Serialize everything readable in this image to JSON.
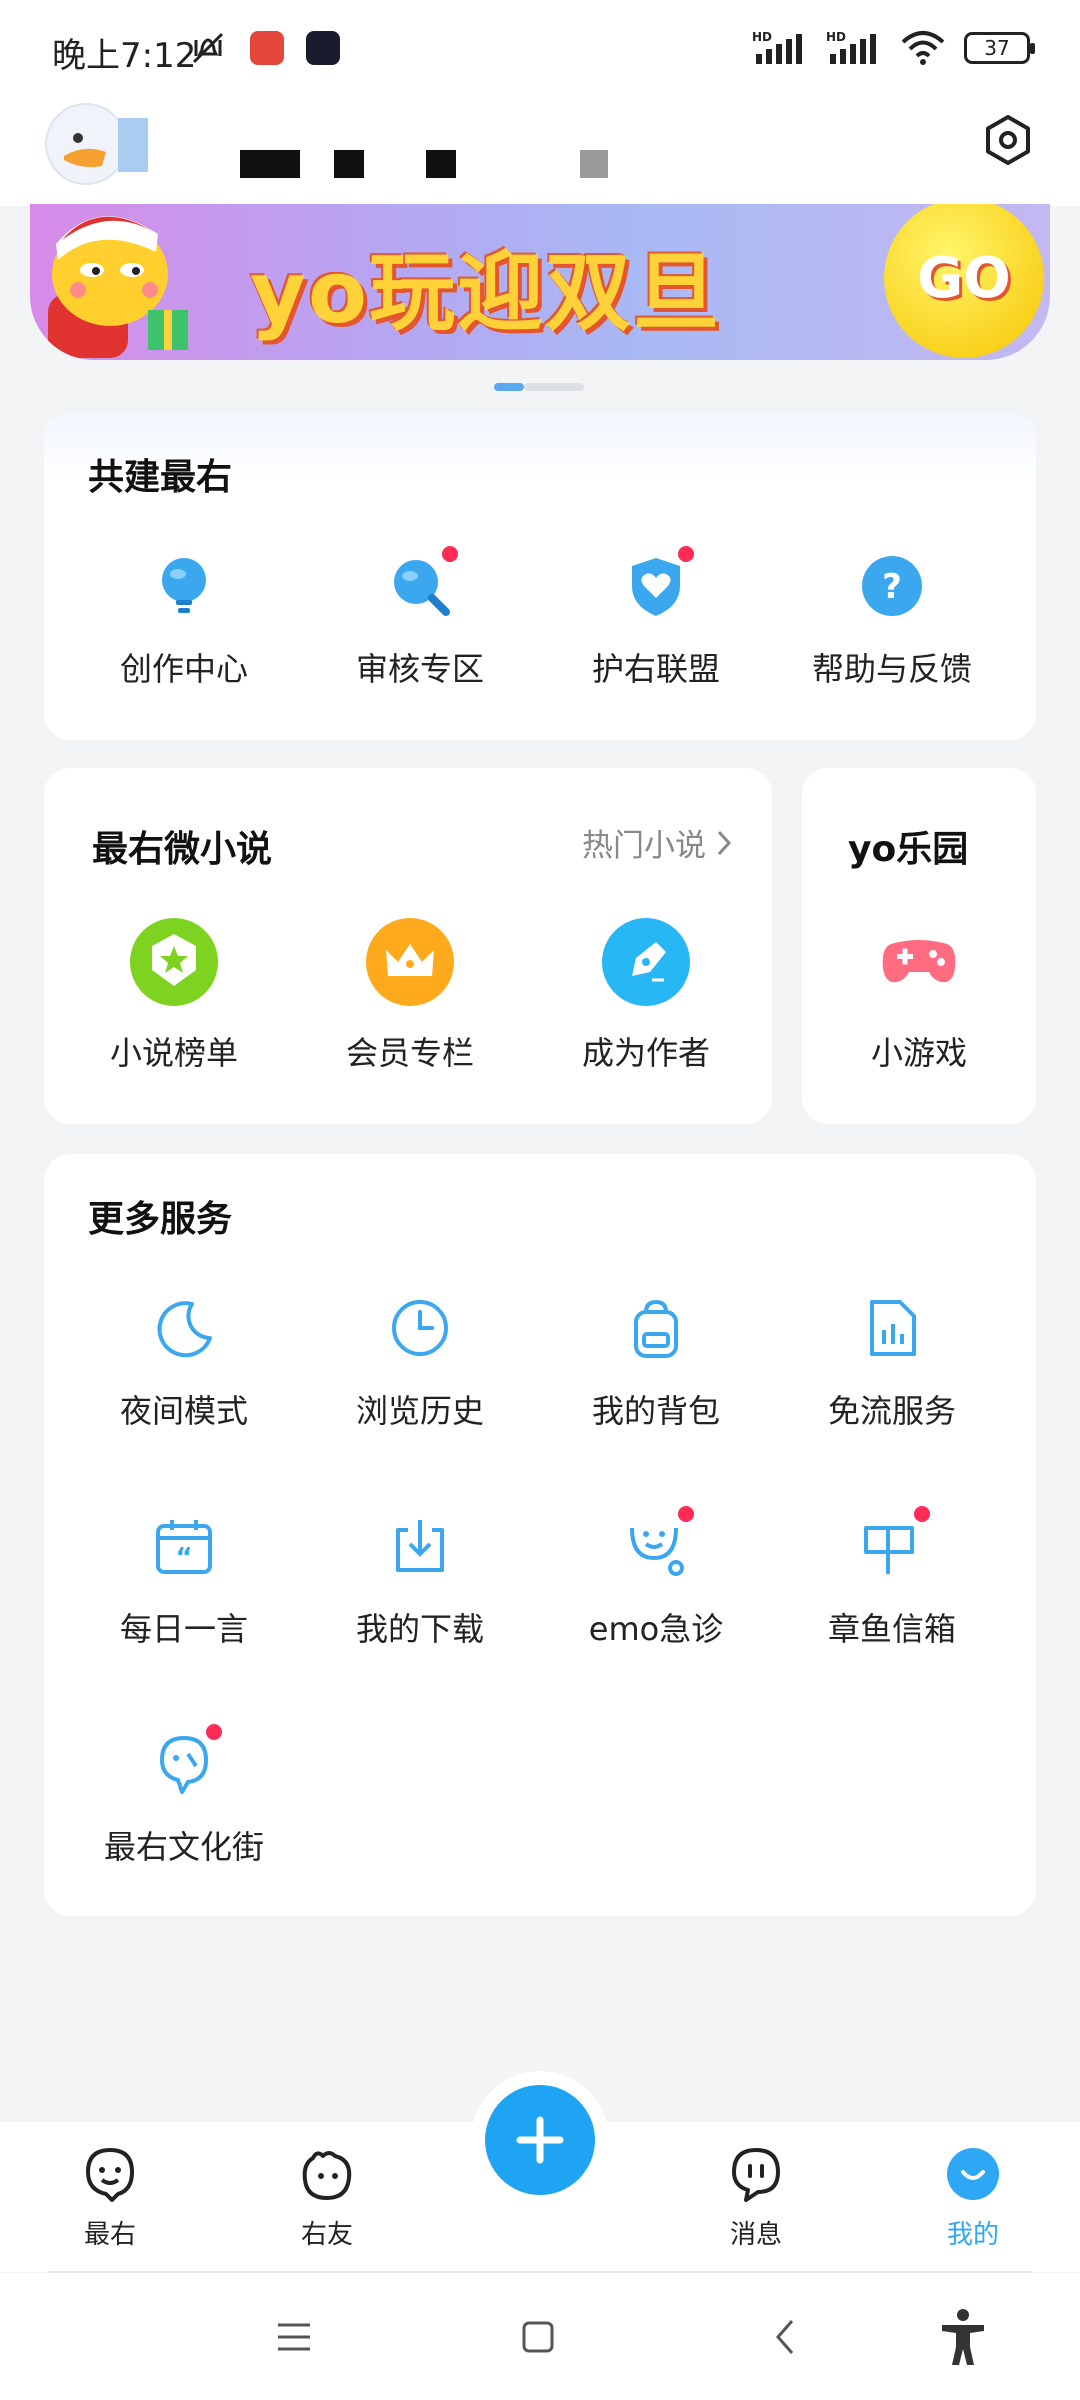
{
  "status_bar": {
    "time": "晚上7:12",
    "battery": "37",
    "signal_label_1": "HD",
    "signal_label_2": "HD"
  },
  "header": {
    "settings_icon": "settings-hexagon-icon"
  },
  "banner": {
    "text": "yo玩迎双旦",
    "go": "GO"
  },
  "build_card": {
    "title": "共建最右",
    "items": [
      {
        "label": "创作中心",
        "icon": "lightbulb-icon",
        "badge": false
      },
      {
        "label": "审核专区",
        "icon": "magnifier-icon",
        "badge": true
      },
      {
        "label": "护右联盟",
        "icon": "shield-heart-icon",
        "badge": true
      },
      {
        "label": "帮助与反馈",
        "icon": "help-icon",
        "badge": false
      }
    ]
  },
  "novel_card": {
    "title": "最右微小说",
    "hot_link": "热门小说",
    "items": [
      {
        "label": "小说榜单",
        "icon": "ranking-badge-icon"
      },
      {
        "label": "会员专栏",
        "icon": "crown-icon"
      },
      {
        "label": "成为作者",
        "icon": "pen-icon"
      }
    ]
  },
  "park_card": {
    "title": "yo乐园",
    "items": [
      {
        "label": "小游戏",
        "icon": "gamepad-icon"
      }
    ]
  },
  "more_card": {
    "title": "更多服务",
    "items": [
      {
        "label": "夜间模式",
        "icon": "moon-icon",
        "badge": false
      },
      {
        "label": "浏览历史",
        "icon": "clock-icon",
        "badge": false
      },
      {
        "label": "我的背包",
        "icon": "backpack-icon",
        "badge": false
      },
      {
        "label": "免流服务",
        "icon": "data-file-icon",
        "badge": false
      },
      {
        "label": "每日一言",
        "icon": "calendar-quote-icon",
        "badge": false
      },
      {
        "label": "我的下载",
        "icon": "download-icon",
        "badge": false
      },
      {
        "label": "emo急诊",
        "icon": "stethoscope-icon",
        "badge": true
      },
      {
        "label": "章鱼信箱",
        "icon": "mailbox-icon",
        "badge": true
      },
      {
        "label": "最右文化街",
        "icon": "culture-street-icon",
        "badge": true
      }
    ]
  },
  "bottom_nav": {
    "items": [
      {
        "label": "最右",
        "icon": "zuiyou-face-icon"
      },
      {
        "label": "右友",
        "icon": "friend-blob-icon"
      },
      {
        "label": "消息",
        "icon": "message-bubble-icon"
      },
      {
        "label": "我的",
        "icon": "me-smile-icon"
      }
    ],
    "active": "我的"
  },
  "colors": {
    "accent": "#1fa3f3",
    "badge": "#ff2d55",
    "icon_blue": "#3aa7ef"
  }
}
